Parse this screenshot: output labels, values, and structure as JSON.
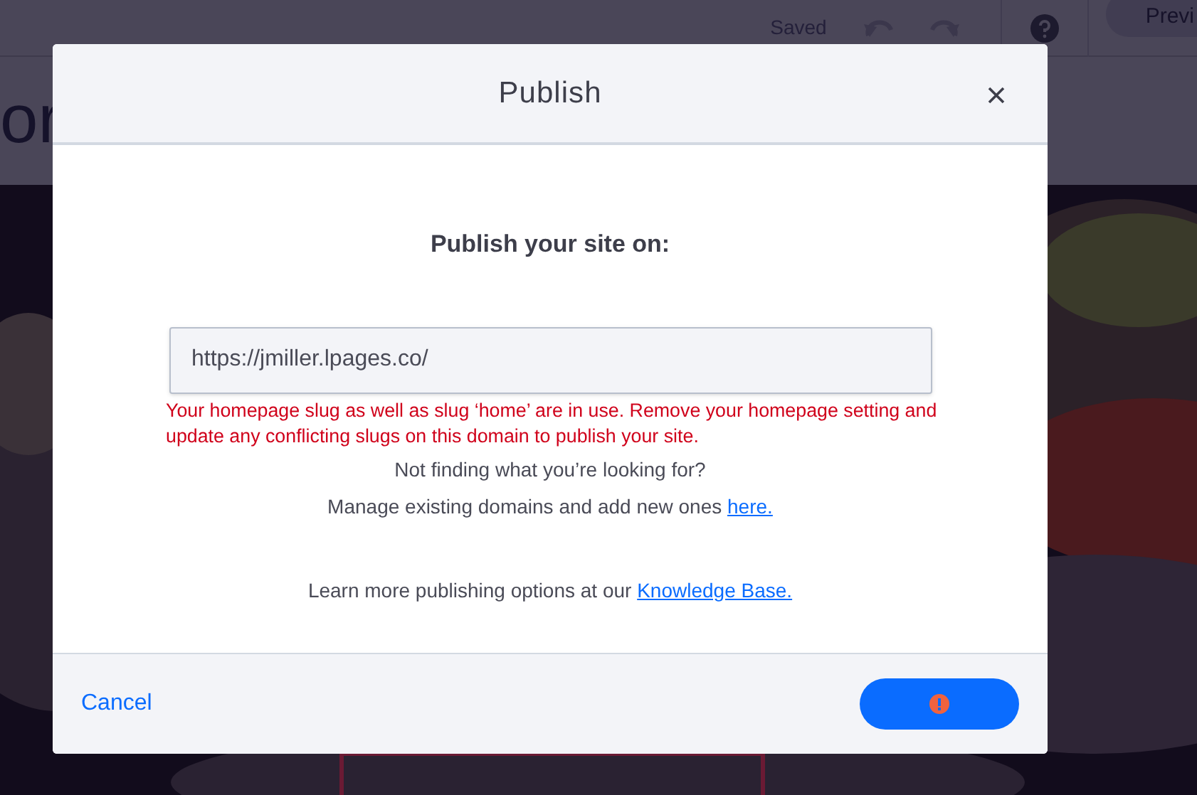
{
  "editor": {
    "save_status": "Saved",
    "preview_button": "Previ",
    "heading_fragment": "or"
  },
  "dialog": {
    "title": "Publish",
    "prompt": "Publish your site on:",
    "url_field": {
      "value": "https://jmiller.lpages.co/"
    },
    "error": "Your homepage slug as well as slug ‘home’ are in use. Remove your homepage setting and update any conflicting slugs on this domain to publish your site.",
    "help_question": "Not finding what you’re looking for?",
    "manage_text": "Manage existing domains and add new ones",
    "manage_link": "here.",
    "learn_text": "Learn more publishing options at our",
    "learn_link": "Knowledge Base.",
    "cancel_button": "Cancel",
    "publish_button": {
      "has_error": true
    }
  }
}
